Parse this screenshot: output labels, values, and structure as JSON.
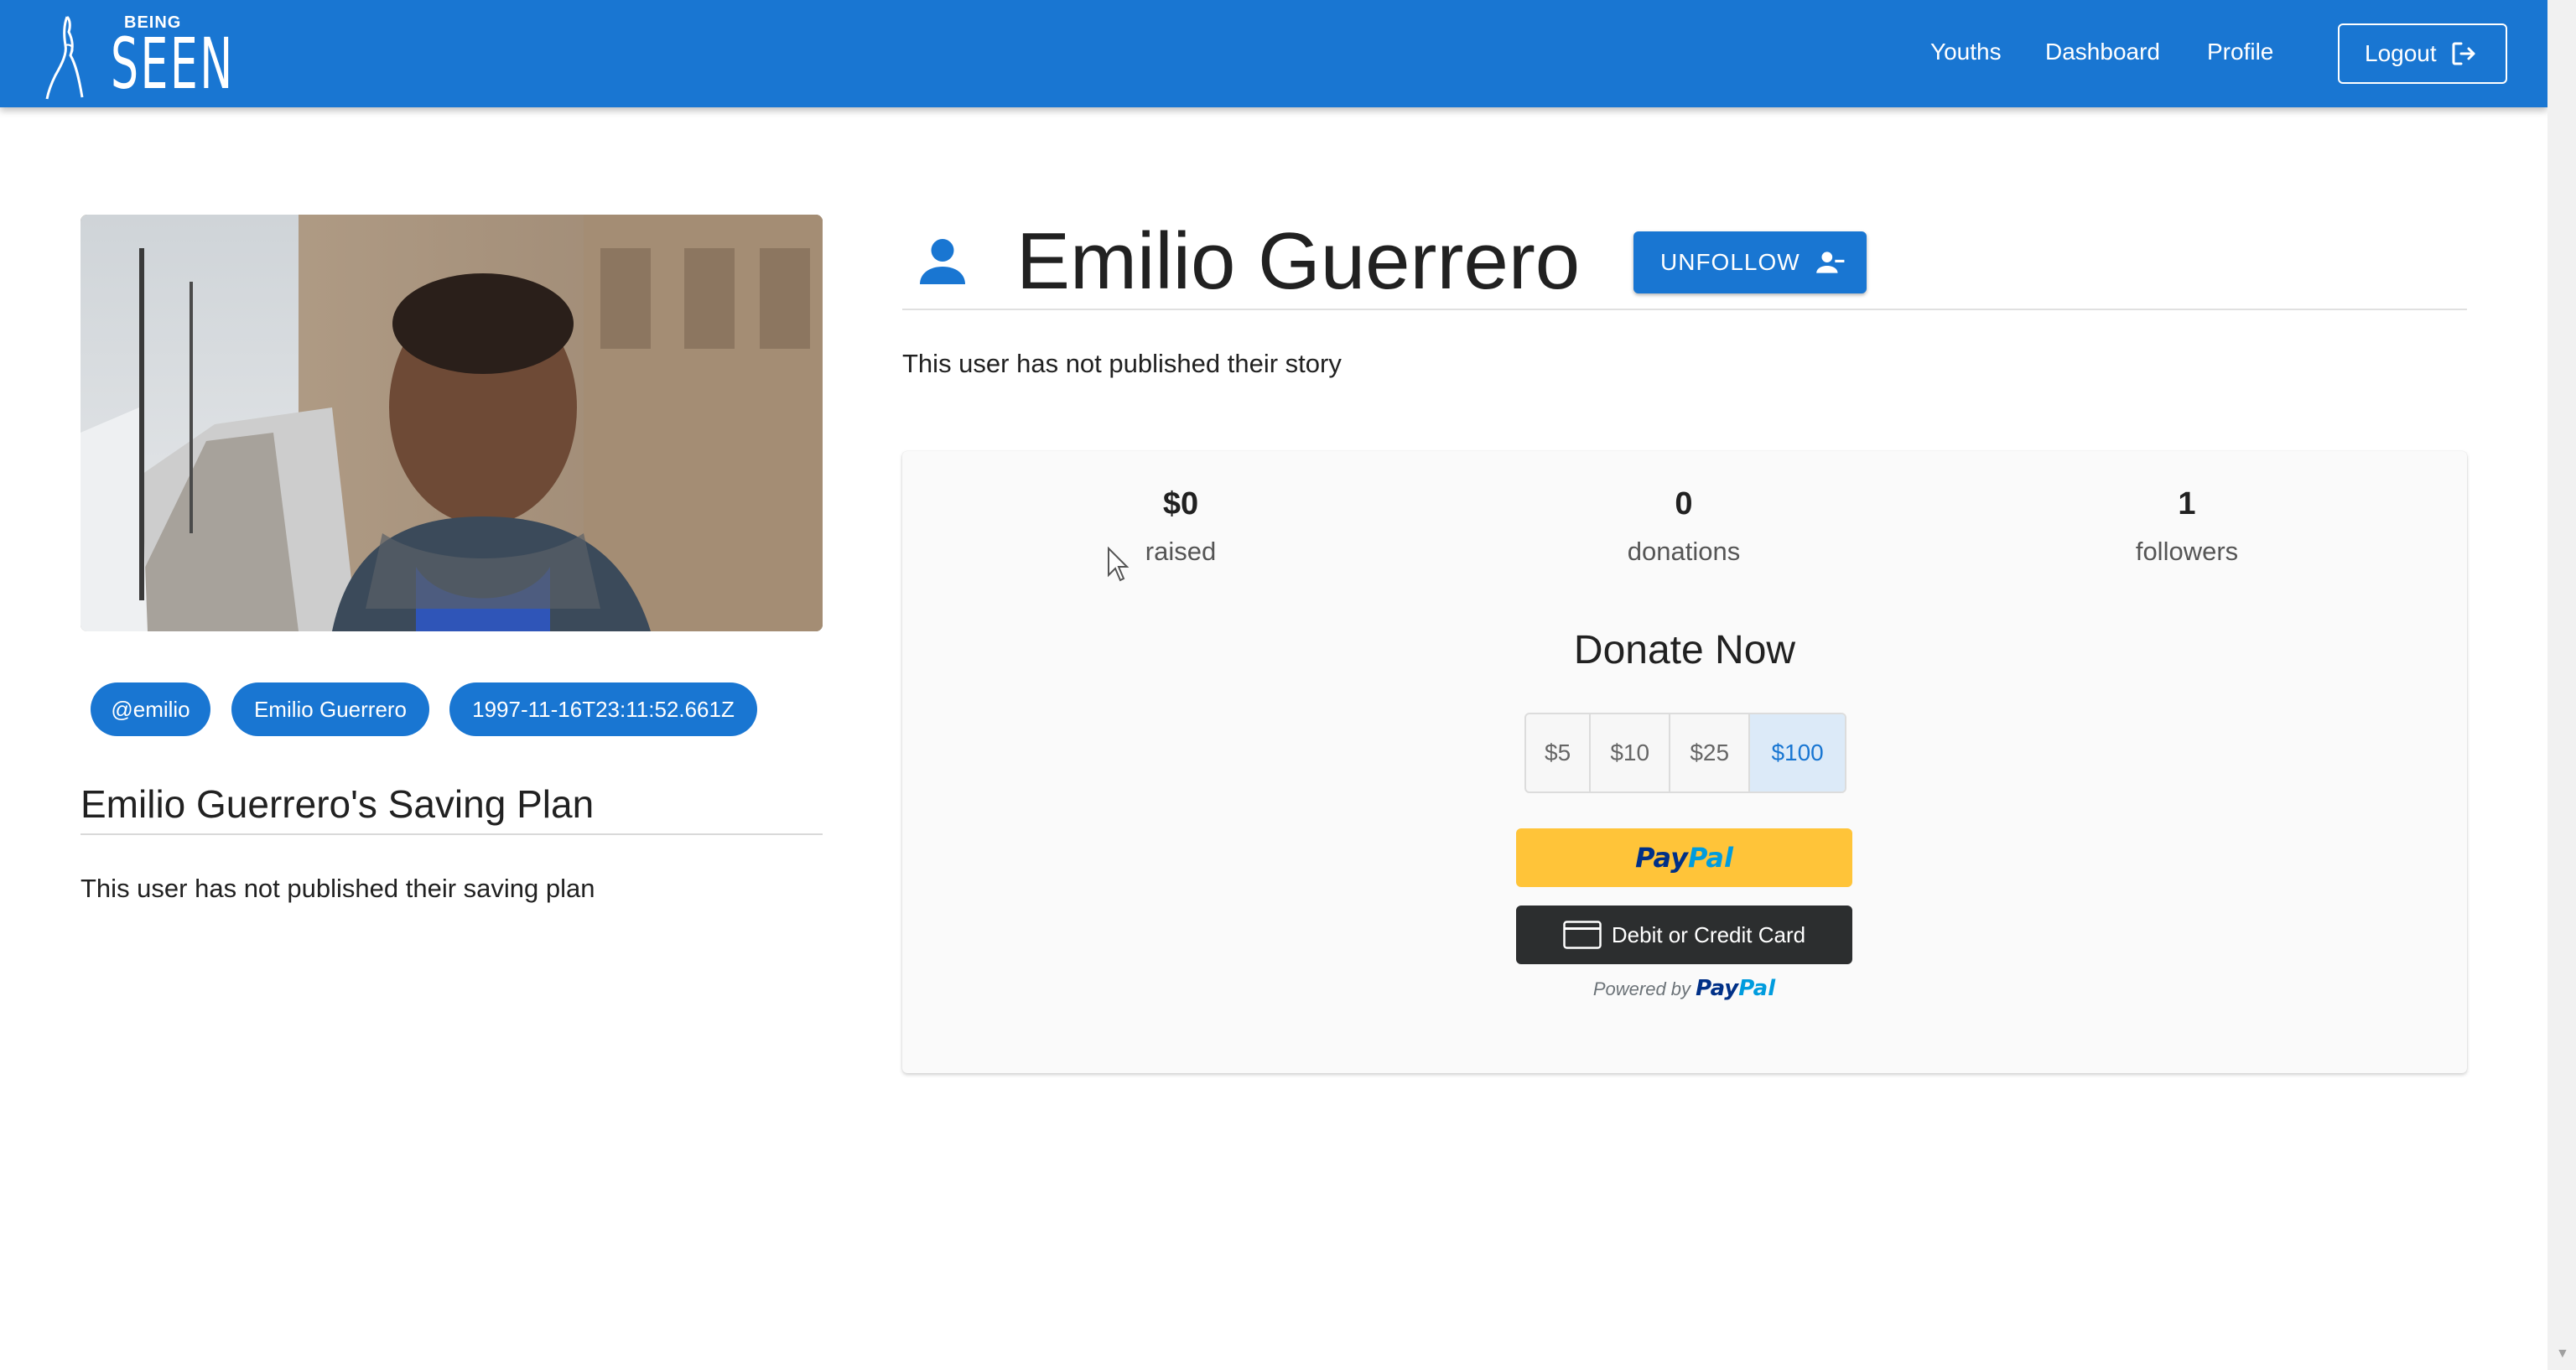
{
  "header": {
    "logo": {
      "top_text": "BEING",
      "main_text": "SEEN"
    },
    "nav": [
      {
        "label": "Youths"
      },
      {
        "label": "Dashboard"
      },
      {
        "label": "Profile"
      }
    ],
    "logout_label": "Logout",
    "color": "#1976d2"
  },
  "sidebar": {
    "chips": [
      "@emilio",
      "Emilio Guerrero",
      "1997-11-16T23:11:52.661Z"
    ],
    "saving_plan_title": "Emilio Guerrero's Saving Plan",
    "saving_plan_text": "This user has not published their saving plan"
  },
  "profile": {
    "name": "Emilio Guerrero",
    "unfollow_label": "UNFOLLOW",
    "story_text": "This user has not published their story"
  },
  "stats": [
    {
      "value": "$0",
      "label": "raised"
    },
    {
      "value": "0",
      "label": "donations"
    },
    {
      "value": "1",
      "label": "followers"
    }
  ],
  "donate": {
    "title": "Donate Now",
    "amounts": [
      "$5",
      "$10",
      "$25",
      "$100"
    ],
    "selected_amount": "$100",
    "paypal_label_a": "Pay",
    "paypal_label_b": "Pal",
    "card_label": "Debit or Credit Card",
    "powered_by": "Powered by"
  },
  "icons": {
    "logout": "logout-icon",
    "person": "person-icon",
    "unfollow": "person-remove-icon",
    "card": "credit-card-icon"
  }
}
